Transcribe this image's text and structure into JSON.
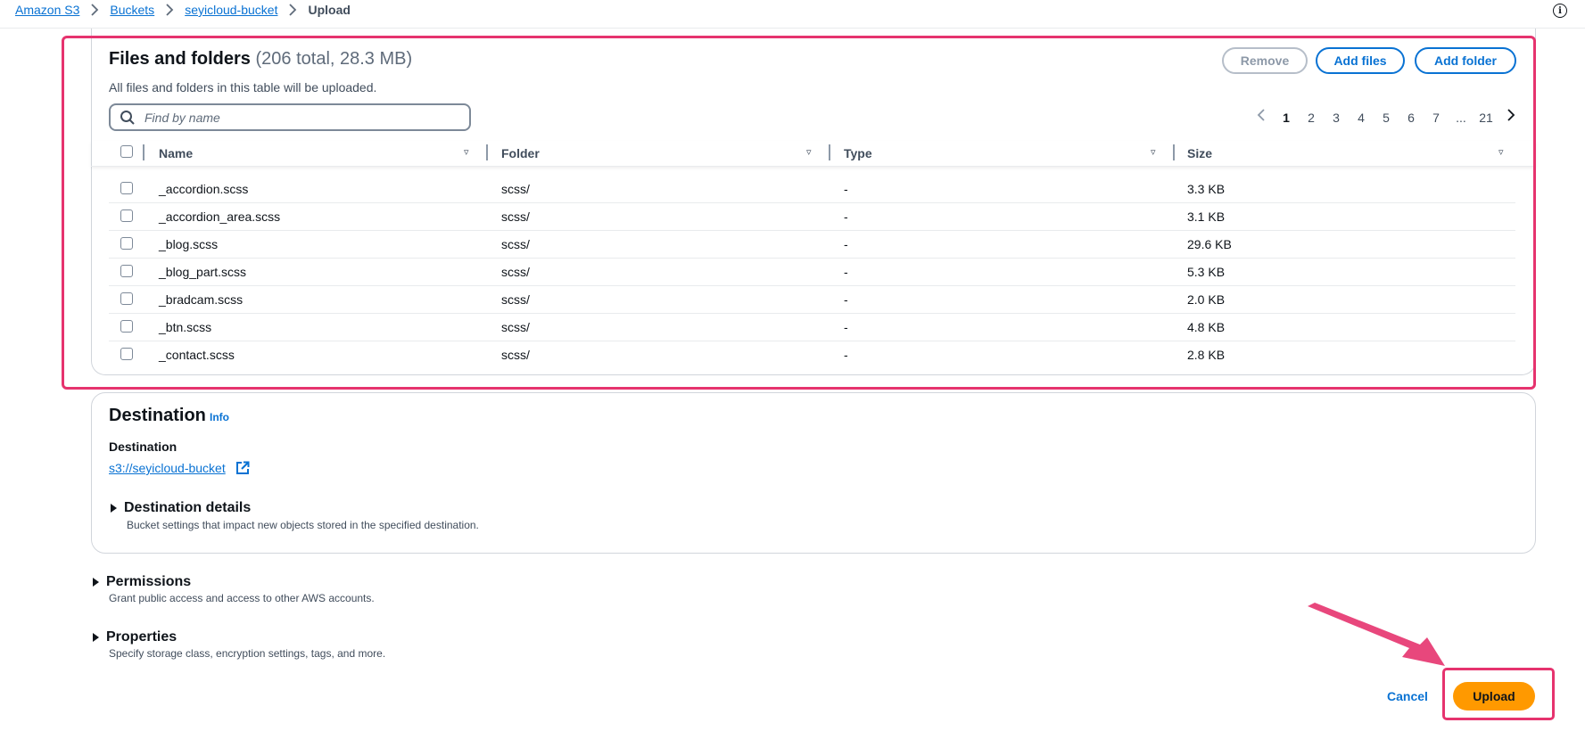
{
  "breadcrumb": {
    "items": [
      "Amazon S3",
      "Buckets",
      "seyicloud-bucket"
    ],
    "current": "Upload"
  },
  "files": {
    "title": "Files and folders",
    "count": "(206 total, 28.3 MB)",
    "description": "All files and folders in this table will be uploaded.",
    "buttons": {
      "remove": "Remove",
      "add_files": "Add files",
      "add_folder": "Add folder"
    },
    "search_placeholder": "Find by name",
    "pagination": {
      "pages": [
        "1",
        "2",
        "3",
        "4",
        "5",
        "6",
        "7",
        "...",
        "21"
      ],
      "current": "1"
    },
    "columns": {
      "name": "Name",
      "folder": "Folder",
      "type": "Type",
      "size": "Size"
    },
    "rows": [
      {
        "name": "_accordion.scss",
        "folder": "scss/",
        "type": "-",
        "size": "3.3 KB"
      },
      {
        "name": "_accordion_area.scss",
        "folder": "scss/",
        "type": "-",
        "size": "3.1 KB"
      },
      {
        "name": "_blog.scss",
        "folder": "scss/",
        "type": "-",
        "size": "29.6 KB"
      },
      {
        "name": "_blog_part.scss",
        "folder": "scss/",
        "type": "-",
        "size": "5.3 KB"
      },
      {
        "name": "_bradcam.scss",
        "folder": "scss/",
        "type": "-",
        "size": "2.0 KB"
      },
      {
        "name": "_btn.scss",
        "folder": "scss/",
        "type": "-",
        "size": "4.8 KB"
      },
      {
        "name": "_contact.scss",
        "folder": "scss/",
        "type": "-",
        "size": "2.8 KB"
      }
    ]
  },
  "destination": {
    "title": "Destination",
    "info": "Info",
    "label": "Destination",
    "url": "s3://seyicloud-bucket",
    "details_title": "Destination details",
    "details_desc": "Bucket settings that impact new objects stored in the specified destination."
  },
  "permissions": {
    "title": "Permissions",
    "desc": "Grant public access and access to other AWS accounts."
  },
  "properties": {
    "title": "Properties",
    "desc": "Specify storage class, encryption settings, tags, and more."
  },
  "footer": {
    "cancel": "Cancel",
    "upload": "Upload"
  },
  "colors": {
    "accent": "#0972d3",
    "upload": "#ff9900",
    "highlight": "#e6336e"
  }
}
